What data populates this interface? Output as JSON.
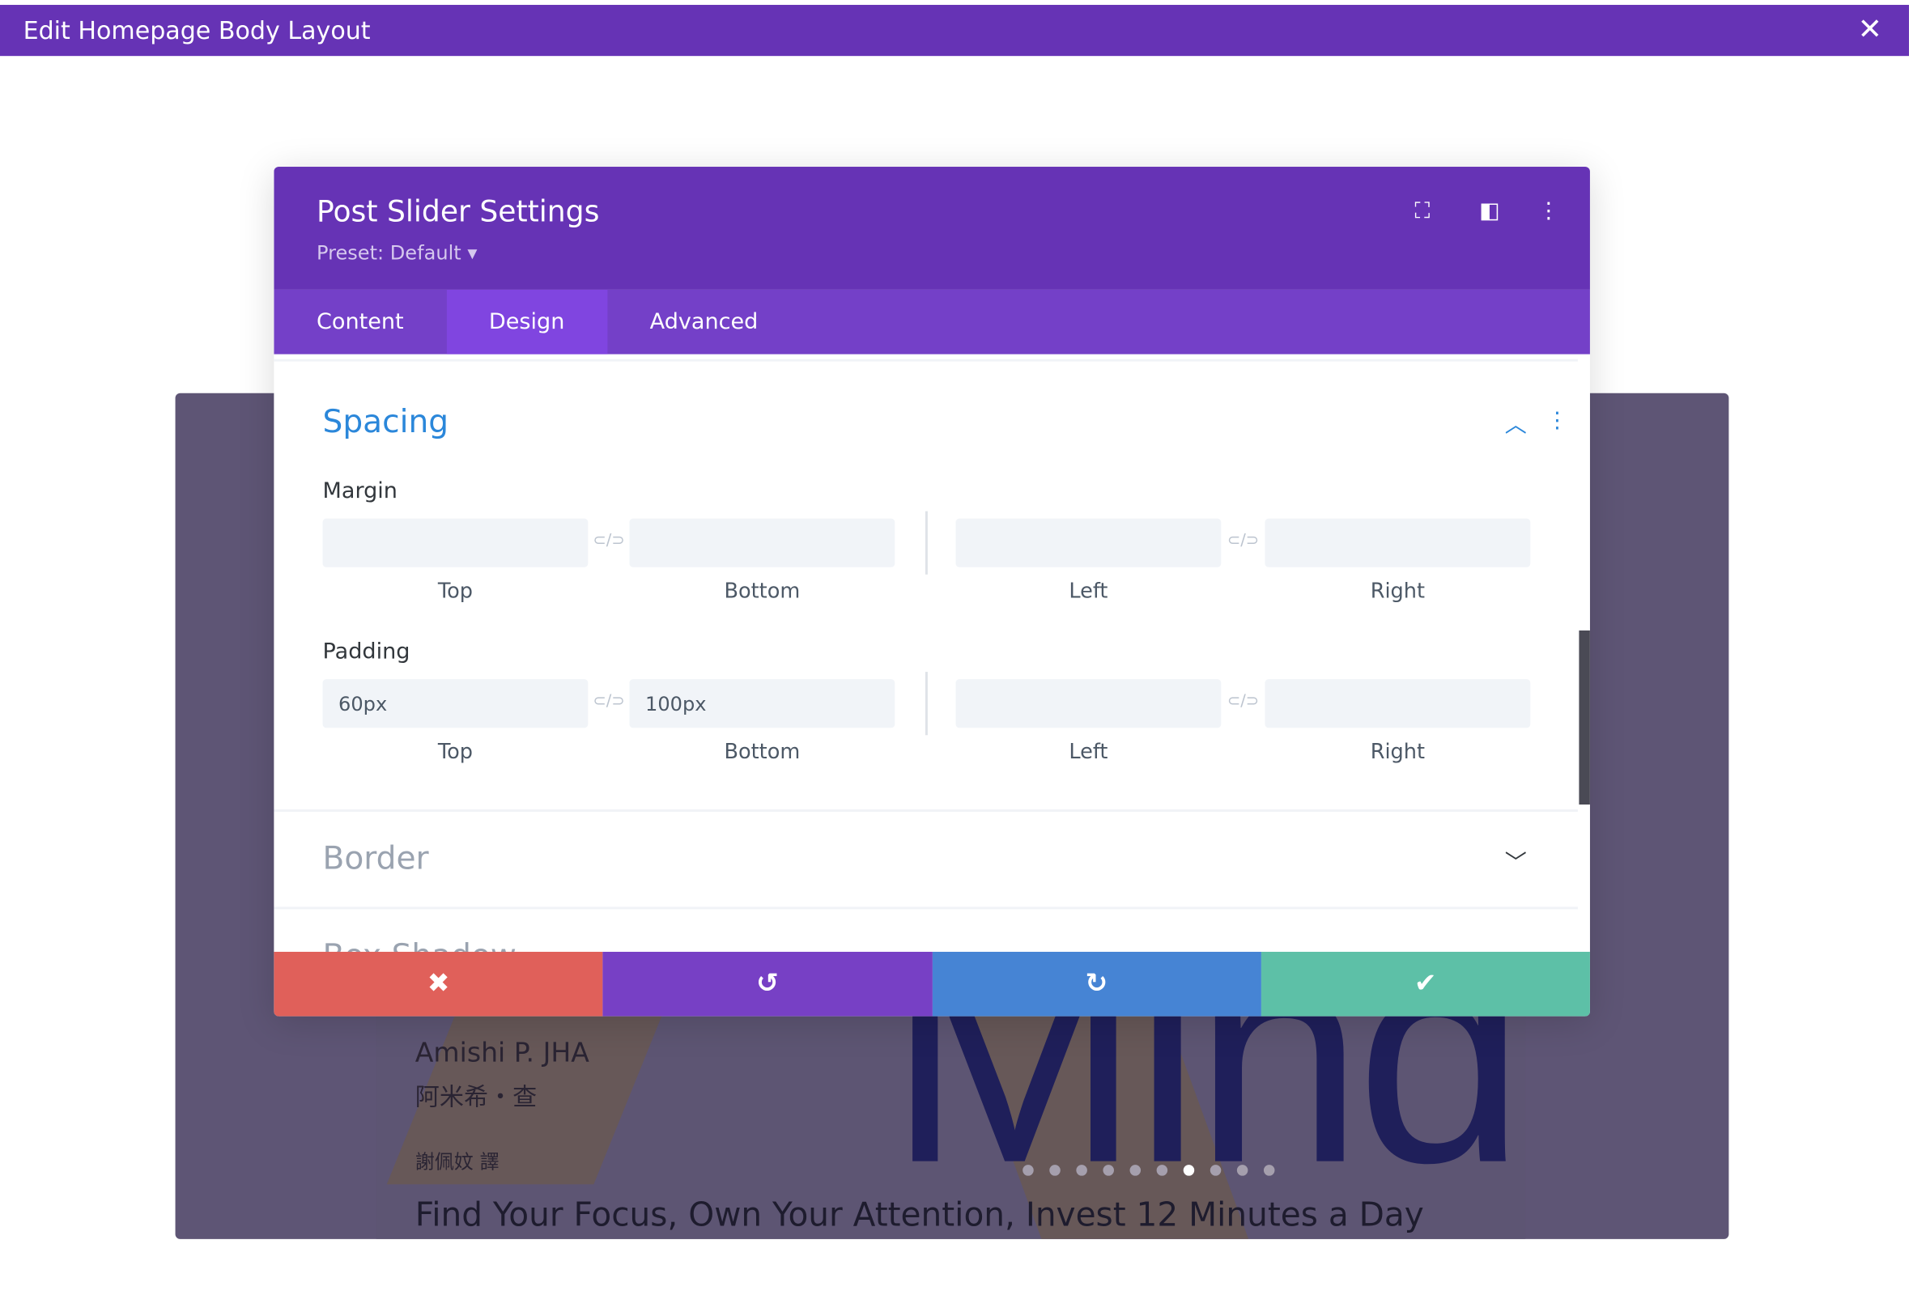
{
  "window": {
    "title": "Edit Homepage Body Layout",
    "close_icon": "close-icon"
  },
  "background": {
    "author": "Amishi P. JHA",
    "author_cn": "阿米希・查",
    "translator": "謝佩妏 譯",
    "book_title": "Mind",
    "tagline": "Find Your Focus, Own Your Attention, Invest 12 Minutes a Day",
    "slide_count": 10,
    "active_slide": 7
  },
  "modal": {
    "title": "Post Slider Settings",
    "preset": "Preset: Default ▾",
    "header_icons": [
      "focus-icon",
      "split-view-icon",
      "more-vertical-icon"
    ],
    "tabs": [
      {
        "label": "Content"
      },
      {
        "label": "Design",
        "active": true
      },
      {
        "label": "Advanced"
      }
    ],
    "spacing": {
      "title": "Spacing",
      "margin": {
        "label": "Margin",
        "fields": [
          {
            "value": "",
            "sub": "Top"
          },
          {
            "value": "",
            "sub": "Bottom"
          },
          {
            "value": "",
            "sub": "Left"
          },
          {
            "value": "",
            "sub": "Right"
          }
        ]
      },
      "padding": {
        "label": "Padding",
        "fields": [
          {
            "value": "60px",
            "sub": "Top"
          },
          {
            "value": "100px",
            "sub": "Bottom"
          },
          {
            "value": "",
            "sub": "Left"
          },
          {
            "value": "",
            "sub": "Right"
          }
        ]
      }
    },
    "border": {
      "title": "Border"
    },
    "box_shadow": {
      "title": "Box Shadow"
    },
    "footer": {
      "cancel": "✖",
      "undo": "↺",
      "redo": "↻",
      "save": "✔"
    },
    "colors": {
      "header": "#6633b5",
      "tabs": "#7440c8",
      "active_tab": "#8045e0",
      "accent": "#2b87da",
      "cancel": "#e0605a",
      "undo": "#7740c5",
      "redo": "#4684d4",
      "save": "#5dc0a7"
    }
  }
}
